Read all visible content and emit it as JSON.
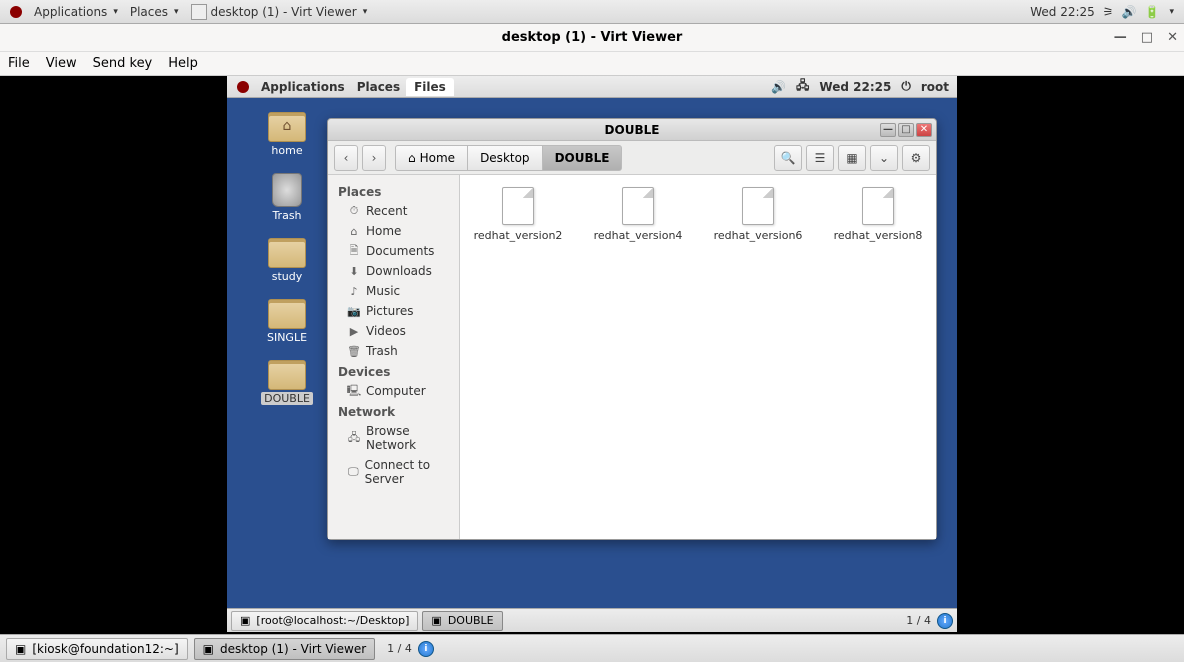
{
  "host": {
    "top": {
      "applications": "Applications",
      "places": "Places",
      "active_app": "desktop (1) - Virt Viewer",
      "clock": "Wed 22:25"
    },
    "virt_window": {
      "title": "desktop (1) - Virt Viewer",
      "menu": {
        "file": "File",
        "view": "View",
        "sendkey": "Send key",
        "help": "Help"
      }
    },
    "bottom": {
      "task1": "[kiosk@foundation12:~]",
      "task2": "desktop (1) - Virt Viewer",
      "workspace": "1 / 4"
    }
  },
  "guest": {
    "top": {
      "applications": "Applications",
      "places": "Places",
      "active_app": "Files",
      "clock": "Wed 22:25",
      "user": "root"
    },
    "desktop_icons": [
      {
        "name": "home"
      },
      {
        "name": "Trash"
      },
      {
        "name": "study"
      },
      {
        "name": "SINGLE"
      },
      {
        "name": "DOUBLE"
      }
    ],
    "nautilus": {
      "title": "DOUBLE",
      "path": [
        {
          "label": "Home",
          "icon": "home"
        },
        {
          "label": "Desktop"
        },
        {
          "label": "DOUBLE",
          "active": true
        }
      ],
      "sidebar": {
        "places_head": "Places",
        "places": [
          {
            "icon": "⏱",
            "label": "Recent"
          },
          {
            "icon": "⌂",
            "label": "Home"
          },
          {
            "icon": "🗎",
            "label": "Documents"
          },
          {
            "icon": "⬇",
            "label": "Downloads"
          },
          {
            "icon": "♪",
            "label": "Music"
          },
          {
            "icon": "📷",
            "label": "Pictures"
          },
          {
            "icon": "▶",
            "label": "Videos"
          },
          {
            "icon": "🗑",
            "label": "Trash"
          }
        ],
        "devices_head": "Devices",
        "devices": [
          {
            "icon": "🖳",
            "label": "Computer"
          }
        ],
        "network_head": "Network",
        "network": [
          {
            "icon": "🖧",
            "label": "Browse Network"
          },
          {
            "icon": "🖵",
            "label": "Connect to Server"
          }
        ]
      },
      "files": [
        "redhat_version2",
        "redhat_version4",
        "redhat_version6",
        "redhat_version8"
      ]
    },
    "bottom": {
      "task1": "[root@localhost:~/Desktop]",
      "task2": "DOUBLE",
      "workspace": "1 / 4"
    }
  }
}
